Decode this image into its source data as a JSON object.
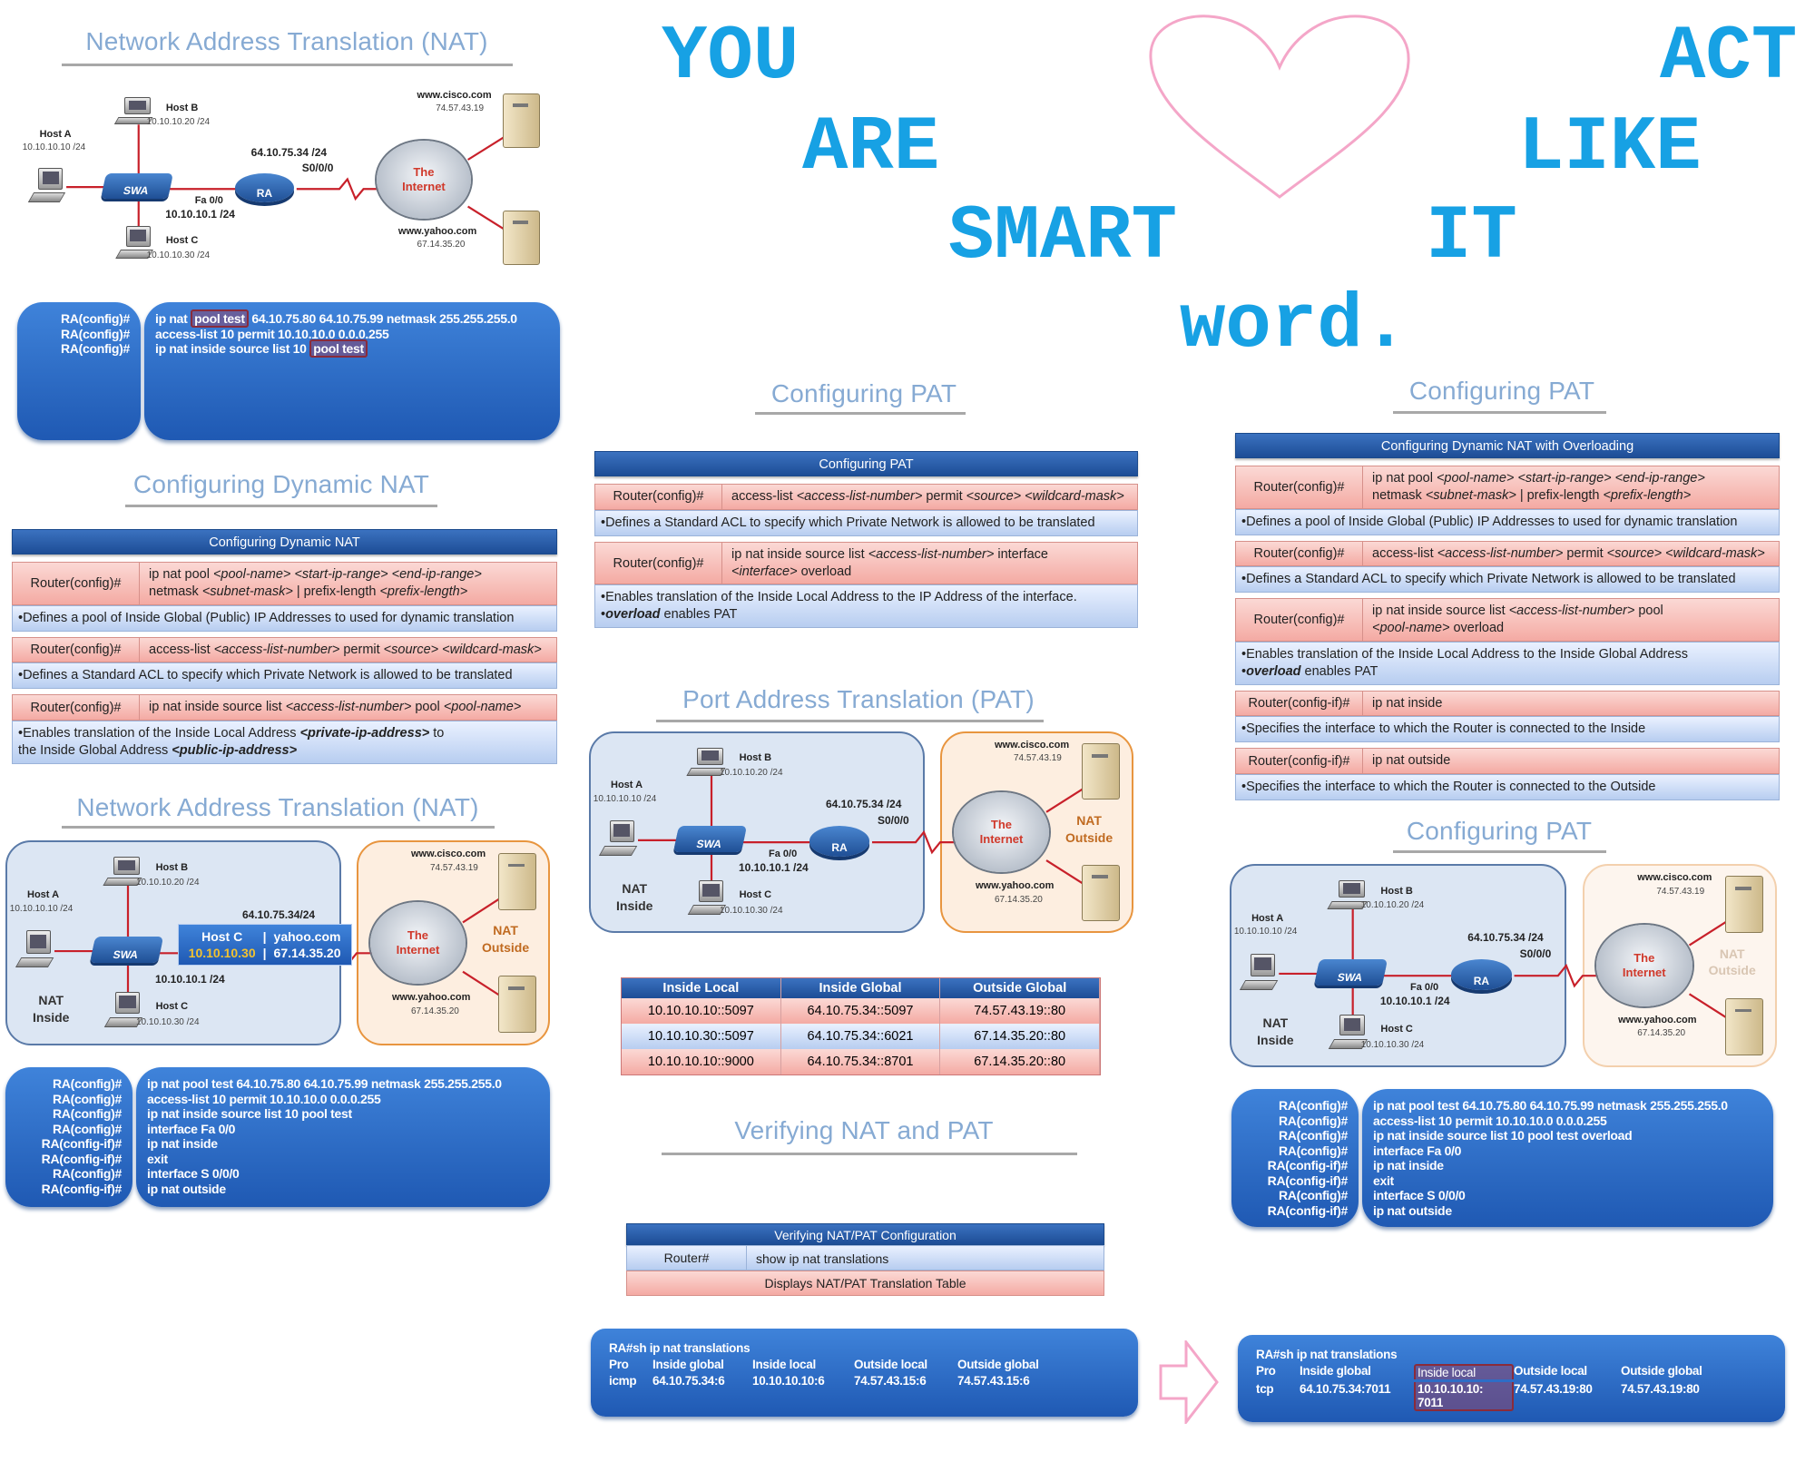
{
  "colors": {
    "accent_words": "#17a1e4",
    "heart": "#f4a6c8",
    "title": "#86aad3",
    "slide_blue": "#1f59b3",
    "cmd_row": "#f4aaa3",
    "desc_row": "#b7cdf0"
  },
  "overlay": {
    "words": [
      "YOU",
      "ARE",
      "SMART",
      "word.",
      "IT",
      "LIKE",
      "ACT"
    ],
    "heart_icon": "heart-outline"
  },
  "titles": {
    "nat_top": "Network Address Translation (NAT)",
    "dyn_nat": "Configuring Dynamic NAT",
    "nat_mid": "Network Address Translation (NAT)",
    "pat_center": "Configuring PAT",
    "pat_port": "Port Address Translation (PAT)",
    "verify": "Verifying NAT and PAT",
    "pat_right": "Configuring PAT",
    "pat_right2": "Configuring PAT"
  },
  "diagrams": {
    "d1": {
      "host_a": {
        "name": "Host A",
        "ip": "10.10.10.10 /24"
      },
      "host_b": {
        "name": "Host B",
        "ip": "10.10.10.20 /24"
      },
      "host_c": {
        "name": "Host C",
        "ip": "10.10.10.30 /24"
      },
      "switch": "SWA",
      "router": "RA",
      "fa": "Fa 0/0",
      "lan_ip": "10.10.10.1 /24",
      "wan_ip": "64.10.75.34 /24",
      "serial": "S0/0/0",
      "cloud": [
        "The",
        "Internet"
      ],
      "cisco": {
        "name": "www.cisco.com",
        "ip": "74.57.43.19"
      },
      "yahoo": {
        "name": "www.yahoo.com",
        "ip": "67.14.35.20"
      }
    },
    "d2": {
      "panels": true,
      "host_a": {
        "name": "Host A",
        "ip": "10.10.10.10 /24"
      },
      "host_b": {
        "name": "Host B",
        "ip": "10.10.10.20 /24"
      },
      "host_c": {
        "name": "Host C",
        "ip": "10.10.10.30 /24"
      },
      "switch": "SWA",
      "lan_ip": "10.10.10.1 /24",
      "wan_ip": "64.10.75.34/24",
      "cloud": [
        "The",
        "Internet"
      ],
      "cisco": {
        "name": "www.cisco.com",
        "ip": "74.57.43.19"
      },
      "yahoo": {
        "name": "www.yahoo.com",
        "ip": "67.14.35.20"
      },
      "inside": [
        "NAT",
        "Inside"
      ],
      "outside": [
        "NAT",
        "Outside"
      ],
      "popup": {
        "left_name": "Host C",
        "sep": "|",
        "right_name": "yahoo.com",
        "left_ip": "10.10.10.30",
        "right_ip": "67.14.35.20"
      }
    },
    "d3": {
      "panels": true,
      "host_a": {
        "name": "Host A",
        "ip": "10.10.10.10 /24"
      },
      "host_b": {
        "name": "Host B",
        "ip": "10.10.10.20 /24"
      },
      "host_c": {
        "name": "Host C",
        "ip": "10.10.10.30 /24"
      },
      "switch": "SWA",
      "router": "RA",
      "fa": "Fa 0/0",
      "lan_ip": "10.10.10.1 /24",
      "wan_ip": "64.10.75.34 /24",
      "serial": "S0/0/0",
      "cloud": [
        "The",
        "Internet"
      ],
      "cisco": {
        "name": "www.cisco.com",
        "ip": "74.57.43.19"
      },
      "yahoo": {
        "name": "www.yahoo.com",
        "ip": "67.14.35.20"
      },
      "inside": [
        "NAT",
        "Inside"
      ],
      "outside": [
        "NAT",
        "Outside"
      ]
    },
    "d4": {
      "panels": true,
      "outside_faded": true,
      "host_a": {
        "name": "Host A",
        "ip": "10.10.10.10 /24"
      },
      "host_b": {
        "name": "Host B",
        "ip": "10.10.10.20 /24"
      },
      "host_c": {
        "name": "Host C",
        "ip": "10.10.10.30 /24"
      },
      "switch": "SWA",
      "router": "RA",
      "fa": "Fa 0/0",
      "lan_ip": "10.10.10.1 /24",
      "wan_ip": "64.10.75.34 /24",
      "serial": "S0/0/0",
      "cloud": [
        "The",
        "Internet"
      ],
      "cisco": {
        "name": "www.cisco.com",
        "ip": "74.57.43.19"
      },
      "yahoo": {
        "name": "www.yahoo.com",
        "ip": "67.14.35.20"
      },
      "inside": [
        "NAT",
        "Inside"
      ],
      "outside": [
        "NAT",
        "Outside"
      ]
    }
  },
  "configs": {
    "c1": {
      "prompts": [
        "RA(config)#",
        "RA(config)#",
        "RA(config)#"
      ],
      "lines": [
        [
          {
            "t": "ip nat "
          },
          {
            "t": "pool test",
            "hl": true
          },
          {
            "t": " 64.10.75.80 64.10.75.99 netmask 255.255.255.0"
          }
        ],
        [
          {
            "t": "access-list 10 permit 10.10.10.0 0.0.0.255"
          }
        ],
        [
          {
            "t": "ip nat inside source list 10 "
          },
          {
            "t": "pool test",
            "hl": true
          }
        ]
      ]
    },
    "c2": {
      "prompts": [
        "RA(config)#",
        "RA(config)#",
        "RA(config)#",
        "RA(config)#",
        "RA(config-if)#",
        "RA(config-if)#",
        "RA(config)#",
        "RA(config-if)#"
      ],
      "lines": [
        [
          {
            "t": "ip nat pool test 64.10.75.80 64.10.75.99 netmask 255.255.255.0"
          }
        ],
        [
          {
            "t": "access-list 10 permit 10.10.10.0 0.0.0.255"
          }
        ],
        [
          {
            "t": "ip nat inside source list 10 pool test"
          }
        ],
        [
          {
            "t": "interface Fa 0/0"
          }
        ],
        [
          {
            "t": "ip nat inside"
          }
        ],
        [
          {
            "t": "exit"
          }
        ],
        [
          {
            "t": "interface S 0/0/0"
          }
        ],
        [
          {
            "t": "ip nat outside"
          }
        ]
      ]
    },
    "c4": {
      "prompts": [
        "RA(config)#",
        "RA(config)#",
        "RA(config)#",
        "RA(config)#",
        "RA(config-if)#",
        "RA(config-if)#",
        "RA(config)#",
        "RA(config-if)#"
      ],
      "lines": [
        [
          {
            "t": "ip nat pool test 64.10.75.80 64.10.75.99 netmask 255.255.255.0"
          }
        ],
        [
          {
            "t": "access-list 10 permit 10.10.10.0 0.0.0.255"
          }
        ],
        [
          {
            "t": "ip nat inside source list 10 pool test overload"
          }
        ],
        [
          {
            "t": "interface Fa 0/0"
          }
        ],
        [
          {
            "t": "ip nat inside"
          }
        ],
        [
          {
            "t": "exit"
          }
        ],
        [
          {
            "t": "interface S 0/0/0"
          }
        ],
        [
          {
            "t": "ip nat outside"
          }
        ]
      ]
    }
  },
  "tables": {
    "dyn_nat": {
      "header": "Configuring Dynamic NAT",
      "rows": [
        {
          "type": "cmd",
          "prompt": "Router(config)#",
          "text": [
            {
              "t": "ip nat pool "
            },
            {
              "t": "<pool-name>",
              "i": true
            },
            {
              "t": " "
            },
            {
              "t": "<start-ip-range>",
              "i": true
            },
            {
              "t": " "
            },
            {
              "t": "<end-ip-range>",
              "i": true
            },
            {
              "t": " netmask ",
              "br": true
            },
            {
              "t": "<subnet-mask>",
              "i": true
            },
            {
              "t": " | prefix-length "
            },
            {
              "t": "<prefix-length>",
              "i": true
            }
          ]
        },
        {
          "type": "desc",
          "text": [
            {
              "t": "•Defines a pool of Inside Global (Public) IP Addresses to used for dynamic translation"
            }
          ]
        },
        {
          "type": "cmd",
          "prompt": "Router(config)#",
          "text": [
            {
              "t": "access-list "
            },
            {
              "t": "<access-list-number>",
              "i": true
            },
            {
              "t": " permit "
            },
            {
              "t": "<source>",
              "i": true
            },
            {
              "t": " "
            },
            {
              "t": "<wildcard-mask>",
              "i": true
            }
          ]
        },
        {
          "type": "desc",
          "text": [
            {
              "t": "•Defines a Standard ACL to specify which Private Network is allowed to be translated"
            }
          ]
        },
        {
          "type": "cmd",
          "prompt": "Router(config)#",
          "text": [
            {
              "t": "ip nat inside source list "
            },
            {
              "t": "<access-list-number>",
              "i": true
            },
            {
              "t": " pool "
            },
            {
              "t": "<pool-name>",
              "i": true
            }
          ]
        },
        {
          "type": "desc",
          "text": [
            {
              "t": "•Enables translation of the Inside Local Address "
            },
            {
              "t": "<private-ip-address>",
              "b": true
            },
            {
              "t": " to"
            },
            {
              "t": "the Inside Global Address ",
              "br": true
            },
            {
              "t": "<public-ip-address>",
              "b": true
            }
          ]
        }
      ]
    },
    "pat": {
      "header": "Configuring PAT",
      "rows": [
        {
          "type": "cmd",
          "prompt": "Router(config)#",
          "text": [
            {
              "t": "access-list "
            },
            {
              "t": "<access-list-number>",
              "i": true
            },
            {
              "t": " permit "
            },
            {
              "t": "<source>",
              "i": true
            },
            {
              "t": " "
            },
            {
              "t": "<wildcard-mask>",
              "i": true
            }
          ]
        },
        {
          "type": "desc",
          "text": [
            {
              "t": "•Defines a Standard ACL to specify which Private Network is allowed to be translated"
            }
          ]
        },
        {
          "type": "cmd",
          "prompt": "Router(config)#",
          "text": [
            {
              "t": "ip nat inside source list "
            },
            {
              "t": "<access-list-number>",
              "i": true
            },
            {
              "t": " interface"
            },
            {
              "t": "<interface>",
              "i": true,
              "br": true
            },
            {
              "t": " overload"
            }
          ]
        },
        {
          "type": "desc",
          "text": [
            {
              "t": "•Enables translation of the Inside Local Address to the IP Address of the interface."
            },
            {
              "t": "•",
              "br": true
            },
            {
              "t": "overload",
              "b": true
            },
            {
              "t": "  enables PAT"
            }
          ]
        }
      ]
    },
    "overload": {
      "header": "Configuring Dynamic NAT with Overloading",
      "rows": [
        {
          "type": "cmd",
          "prompt": "Router(config)#",
          "text": [
            {
              "t": "ip nat pool "
            },
            {
              "t": "<pool-name>",
              "i": true
            },
            {
              "t": " "
            },
            {
              "t": "<start-ip-range>",
              "i": true
            },
            {
              "t": " "
            },
            {
              "t": "<end-ip-range>",
              "i": true
            },
            {
              "t": "netmask ",
              "br": true
            },
            {
              "t": "<subnet-mask>",
              "i": true
            },
            {
              "t": " | prefix-length "
            },
            {
              "t": "<prefix-length>",
              "i": true
            }
          ]
        },
        {
          "type": "desc",
          "text": [
            {
              "t": "•Defines a pool of Inside Global (Public) IP Addresses to used for dynamic translation"
            }
          ]
        },
        {
          "type": "cmd",
          "prompt": "Router(config)#",
          "text": [
            {
              "t": "access-list "
            },
            {
              "t": "<access-list-number>",
              "i": true
            },
            {
              "t": " permit "
            },
            {
              "t": "<source>",
              "i": true
            },
            {
              "t": " "
            },
            {
              "t": "<wildcard-mask>",
              "i": true
            }
          ]
        },
        {
          "type": "desc",
          "text": [
            {
              "t": "•Defines a Standard ACL to specify which Private Network is allowed to be translated"
            }
          ]
        },
        {
          "type": "cmd",
          "prompt": "Router(config)#",
          "text": [
            {
              "t": "ip nat inside source list "
            },
            {
              "t": "<access-list-number>",
              "i": true
            },
            {
              "t": " pool"
            },
            {
              "t": "<pool-name>",
              "i": true,
              "br": true
            },
            {
              "t": " overload"
            }
          ]
        },
        {
          "type": "desc",
          "text": [
            {
              "t": "•Enables translation of the Inside Local Address to the Inside Global Address"
            },
            {
              "t": "•",
              "br": true
            },
            {
              "t": "overload",
              "b": true
            },
            {
              "t": "  enables PAT"
            }
          ]
        },
        {
          "type": "cmd",
          "prompt": "Router(config-if)#",
          "text": [
            {
              "t": "ip nat inside"
            }
          ]
        },
        {
          "type": "desc",
          "text": [
            {
              "t": "•Specifies the interface to which the Router is connected to the Inside"
            }
          ]
        },
        {
          "type": "cmd",
          "prompt": "Router(config-if)#",
          "text": [
            {
              "t": "ip nat outside"
            }
          ]
        },
        {
          "type": "desc",
          "text": [
            {
              "t": "•Specifies the interface to which the Router is connected to the Outside"
            }
          ]
        }
      ]
    }
  },
  "translation_table": {
    "columns": [
      "Inside Local",
      "Inside Global",
      "Outside Global"
    ],
    "rows": [
      [
        "10.10.10.10::5097",
        "64.10.75.34::5097",
        "74.57.43.19::80"
      ],
      [
        "10.10.10.30::5097",
        "64.10.75.34::6021",
        "67.14.35.20::80"
      ],
      [
        "10.10.10.10::9000",
        "64.10.75.34::8701",
        "67.14.35.20::80"
      ]
    ]
  },
  "verify_table": {
    "header": "Verifying NAT/PAT Configuration",
    "prompt": "Router#",
    "command": "show ip nat translations",
    "description": "Displays NAT/PAT Translation Table"
  },
  "show_outputs": [
    {
      "command": "RA#sh ip nat translations",
      "columns": [
        "Pro",
        "Inside global",
        "Inside local",
        "Outside local",
        "Outside global"
      ],
      "row": [
        "icmp",
        "64.10.75.34:6",
        "10.10.10.10:6",
        "74.57.43.15:6",
        "74.57.43.15:6"
      ]
    },
    {
      "command": "RA#sh ip nat translations",
      "columns": [
        "Pro",
        "Inside global",
        "Inside local",
        "Outside local",
        "Outside global"
      ],
      "row": [
        "tcp",
        "64.10.75.34:7011",
        "10.10.10.10: 7011",
        "74.57.43.19:80",
        "74.57.43.19:80"
      ],
      "highlighted_column": "Inside local"
    }
  ]
}
